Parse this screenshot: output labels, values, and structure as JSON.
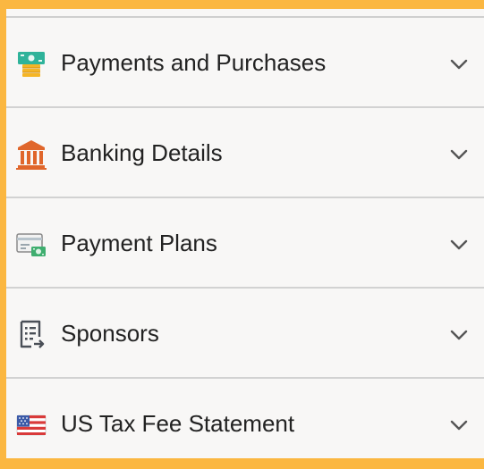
{
  "colors": {
    "page_border": "#fbb741",
    "panel_background": "#f8f7f6",
    "divider": "#d2d2d2",
    "text": "#222222",
    "chevron": "#555555",
    "bank_icon": "#e0662b",
    "money_icon_green": "#2fb39a",
    "money_icon_yellow": "#f5b526"
  },
  "sections": [
    {
      "label": "Payments and Purchases",
      "icon": "money-stack-icon"
    },
    {
      "label": "Banking Details",
      "icon": "bank-icon"
    },
    {
      "label": "Payment Plans",
      "icon": "payment-plan-icon"
    },
    {
      "label": "Sponsors",
      "icon": "sponsor-list-icon"
    },
    {
      "label": "US Tax Fee Statement",
      "icon": "us-flag-icon"
    }
  ]
}
